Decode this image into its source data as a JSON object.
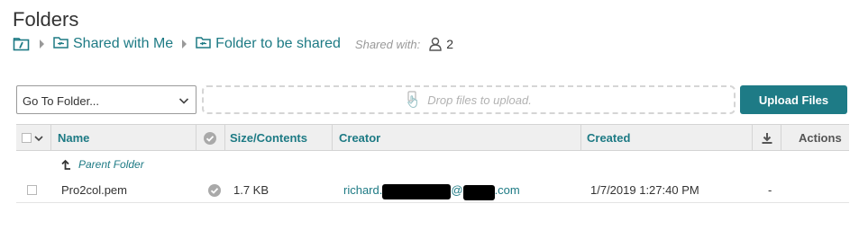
{
  "page": {
    "title": "Folders"
  },
  "breadcrumb": {
    "items": [
      {
        "label": "Shared with Me",
        "icon": "shared-folder-icon"
      },
      {
        "label": "Folder to be shared",
        "icon": "shared-folder-icon"
      }
    ],
    "root_icon": "root-folder-icon",
    "shared_label": "Shared with:",
    "shared_count": "2"
  },
  "toolbar": {
    "goto_value": "Go To Folder...",
    "dropzone_text": "Drop files to upload.",
    "upload_label": "Upload Files"
  },
  "table": {
    "columns": {
      "name": "Name",
      "size": "Size/Contents",
      "creator": "Creator",
      "created": "Created",
      "actions": "Actions"
    },
    "parent_label": "Parent Folder",
    "rows": [
      {
        "name": "Pro2col.pem",
        "size": "1.7 KB",
        "creator_prefix": "richard.",
        "creator_at": "@",
        "creator_suffix": ".com",
        "created": "1/7/2019 1:27:40 PM",
        "download": "-"
      }
    ]
  },
  "colors": {
    "accent": "#1e7b86",
    "link": "#1d7a84",
    "header_bg": "#efefef"
  }
}
